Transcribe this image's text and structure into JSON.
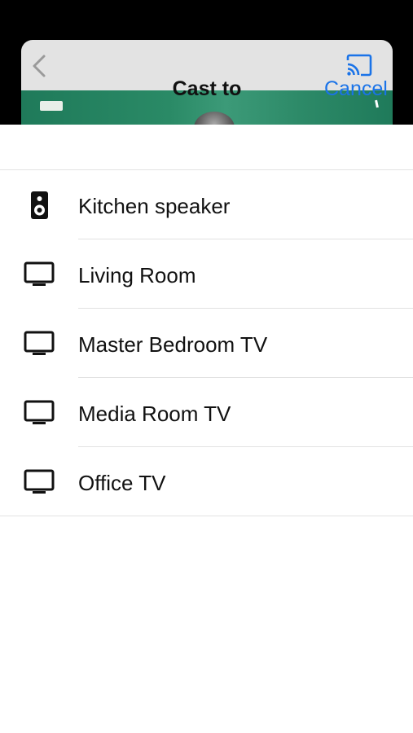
{
  "dialog": {
    "title": "Cast to",
    "cancel_label": "Cancel"
  },
  "devices": [
    {
      "label": "Kitchen speaker",
      "icon": "speaker-icon"
    },
    {
      "label": "Living Room",
      "icon": "tv-icon"
    },
    {
      "label": "Master Bedroom TV",
      "icon": "tv-icon"
    },
    {
      "label": "Media Room TV",
      "icon": "tv-icon"
    },
    {
      "label": "Office TV",
      "icon": "tv-icon"
    }
  ],
  "colors": {
    "accent": "#1a73e8",
    "text": "#111111",
    "divider": "#e2e2e2",
    "header_card": "#e3e3e3"
  }
}
